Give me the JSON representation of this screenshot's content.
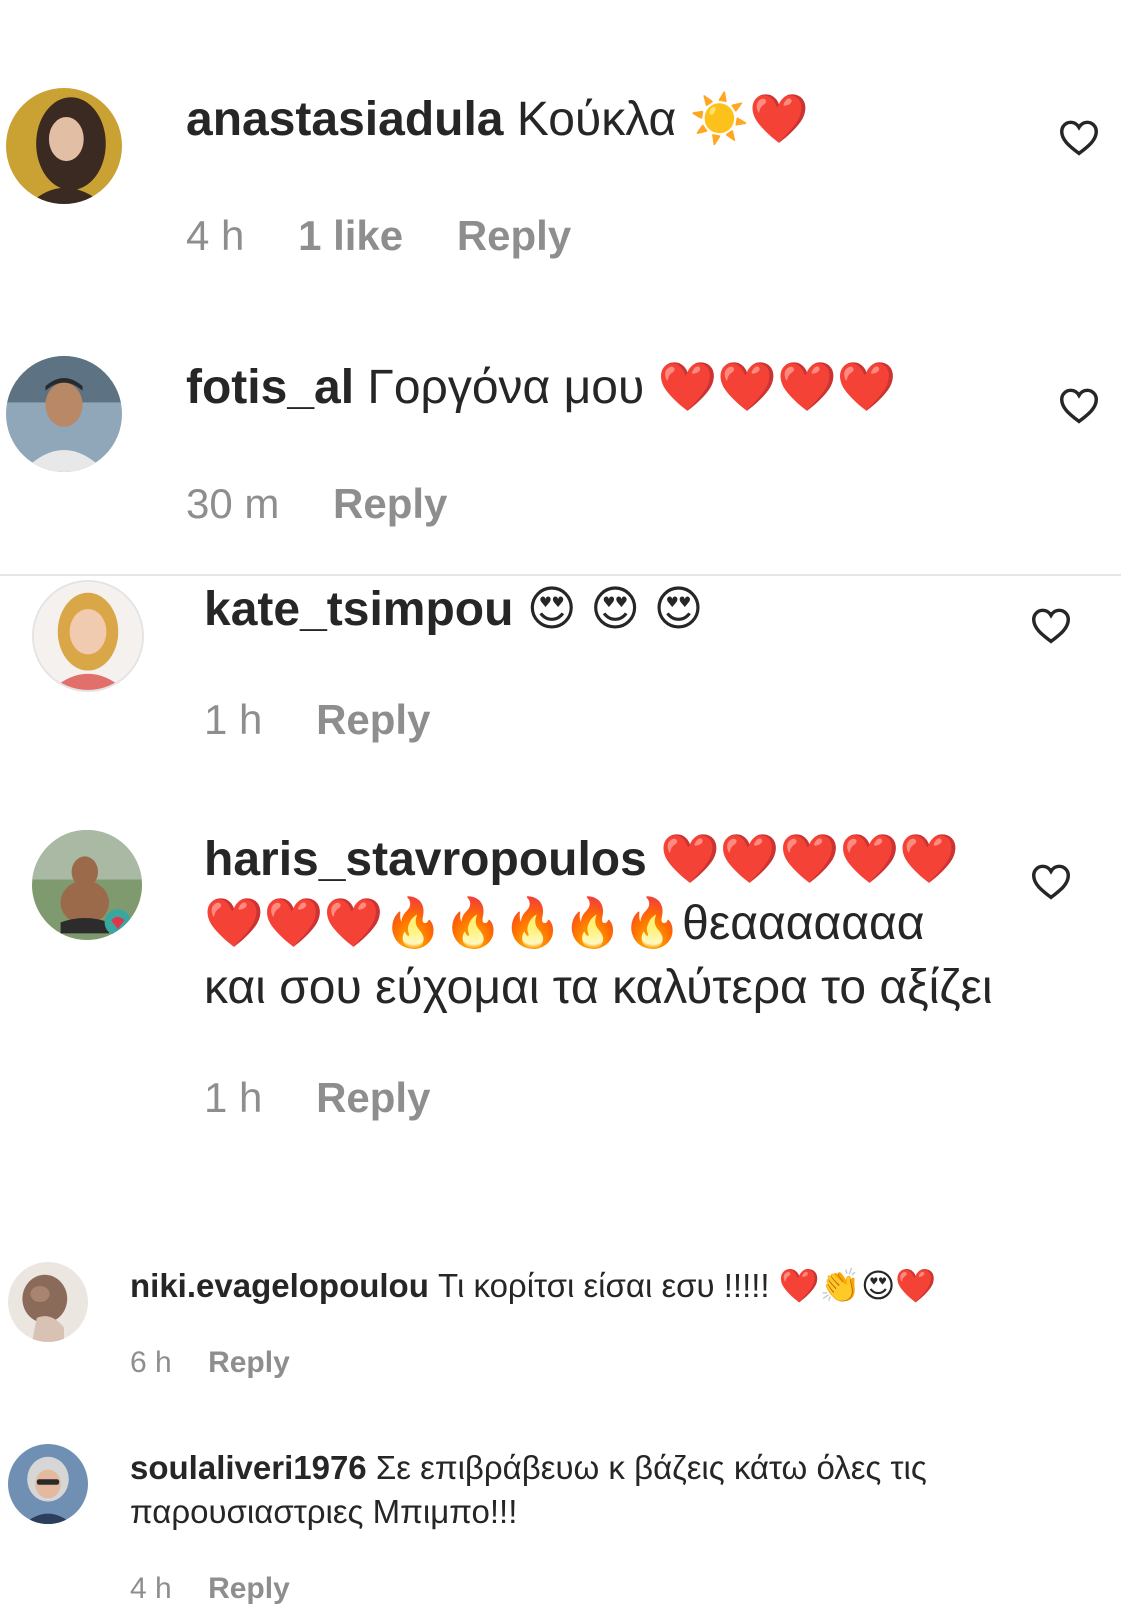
{
  "comments": [
    {
      "username": "anastasiadula",
      "text": "Κούκλα ☀️❤️",
      "time": "4 h",
      "likes": "1 like",
      "reply": "Reply"
    },
    {
      "username": "fotis_al",
      "text": "Γοργόνα μου ❤️❤️❤️❤️",
      "time": "30 m",
      "reply": "Reply"
    },
    {
      "username": "kate_tsimpou",
      "text": "😍 😍 😍",
      "time": "1 h",
      "reply": "Reply"
    },
    {
      "username": "haris_stavropoulos",
      "text": "❤️❤️❤️❤️❤️❤️❤️❤️🔥🔥🔥🔥🔥θεααααααα και σου εύχομαι τα καλύτερα το αξίζει",
      "time": "1 h",
      "reply": "Reply"
    },
    {
      "username": "niki.evagelopoulou",
      "text": "Τι κορίτσι είσαι εσυ !!!!! ❤️👏😍❤️",
      "time": "6 h",
      "reply": "Reply"
    },
    {
      "username": "soulaliveri1976",
      "text": "Σε επιβράβευω κ βάζεις κάτω όλες τις παρουσιαστριες Μπιμπο!!!",
      "time": "4 h",
      "reply": "Reply"
    }
  ],
  "icons": {
    "like": "heart-outline-icon"
  },
  "colors": {
    "text": "#262626",
    "meta": "#8e8e8e",
    "divider": "#e6e6e6"
  }
}
